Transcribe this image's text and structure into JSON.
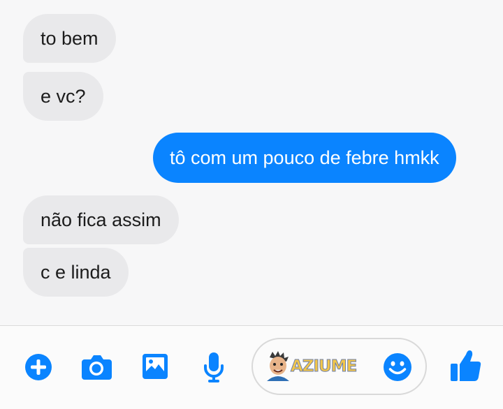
{
  "messages": [
    {
      "side": "incoming",
      "text": "to bem"
    },
    {
      "side": "incoming",
      "text": "e vc?"
    },
    {
      "side": "outgoing",
      "text": "tô com um pouco de febre hmkk"
    },
    {
      "side": "incoming",
      "text": "não fica assim"
    },
    {
      "side": "incoming",
      "text": "c e linda"
    }
  ],
  "composer": {
    "icons": [
      "plus-icon",
      "camera-icon",
      "image-icon",
      "microphone-icon",
      "emoji-icon",
      "thumbs-up-icon"
    ],
    "watermark": "AZIUME"
  },
  "colors": {
    "accent": "#0a84ff",
    "incoming_bubble": "#e9e9eb",
    "background": "#f7f7f8"
  }
}
